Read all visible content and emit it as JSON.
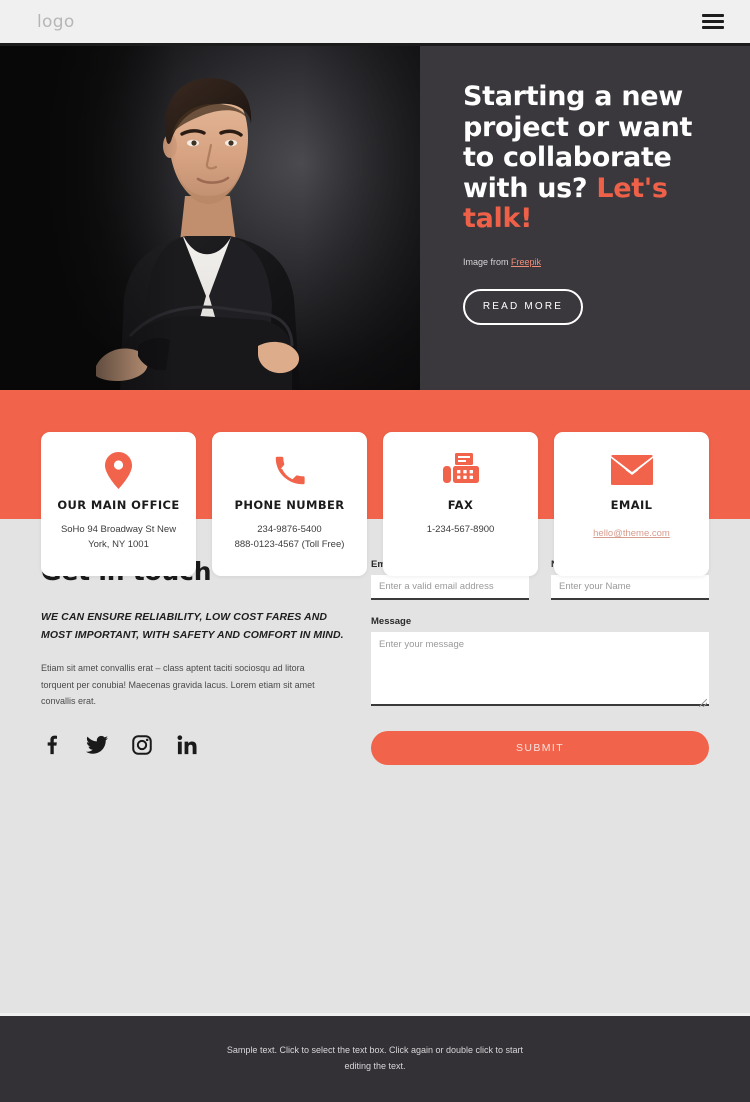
{
  "header": {
    "logo": "logo",
    "menu_icon": "hamburger-icon"
  },
  "hero": {
    "title_line1": "Starting a new",
    "title_line2": "project or want",
    "title_line3": "to collaborate",
    "title_line4_plain": "with us? ",
    "title_line4_accent": "Let's",
    "title_line5_accent": "talk!",
    "credit_prefix": "Image from ",
    "credit_link": "Freepik",
    "cta_label": "READ MORE",
    "bg_color": "#3a383d",
    "accent_color": "#ef6048"
  },
  "band": {
    "color": "#f1634a"
  },
  "cards": [
    {
      "icon": "map-pin-icon",
      "title": "OUR MAIN OFFICE",
      "line1": "SoHo 94 Broadway St New",
      "line2": "York, NY 1001",
      "link": ""
    },
    {
      "icon": "phone-icon",
      "title": "PHONE NUMBER",
      "line1": "234-9876-5400",
      "line2": "888-0123-4567 (Toll Free)",
      "link": ""
    },
    {
      "icon": "fax-icon",
      "title": "FAX",
      "line1": "1-234-567-8900",
      "line2": "",
      "link": ""
    },
    {
      "icon": "envelope-icon",
      "title": "EMAIL",
      "line1": "",
      "line2": "",
      "link": "hello@theme.com"
    }
  ],
  "touch": {
    "heading": "Get in touch",
    "subheading": "WE CAN ENSURE RELIABILITY, LOW COST FARES AND MOST IMPORTANT, WITH SAFETY AND COMFORT IN MIND.",
    "paragraph": "Etiam sit amet convallis erat – class aptent taciti sociosqu ad litora torquent per conubia! Maecenas gravida lacus. Lorem etiam sit amet convallis erat.",
    "socials": [
      {
        "name": "facebook-icon"
      },
      {
        "name": "twitter-icon"
      },
      {
        "name": "instagram-icon"
      },
      {
        "name": "linkedin-icon"
      }
    ]
  },
  "form": {
    "email_label": "Email",
    "email_placeholder": "Enter a valid email address",
    "email_value": "",
    "name_label": "Name",
    "name_placeholder": "Enter your Name",
    "name_value": "",
    "message_label": "Message",
    "message_placeholder": "Enter your message",
    "message_value": "",
    "submit_label": "SUBMIT"
  },
  "footer": {
    "text": "Sample text. Click to select the text box. Click again or double click to start editing the text."
  }
}
